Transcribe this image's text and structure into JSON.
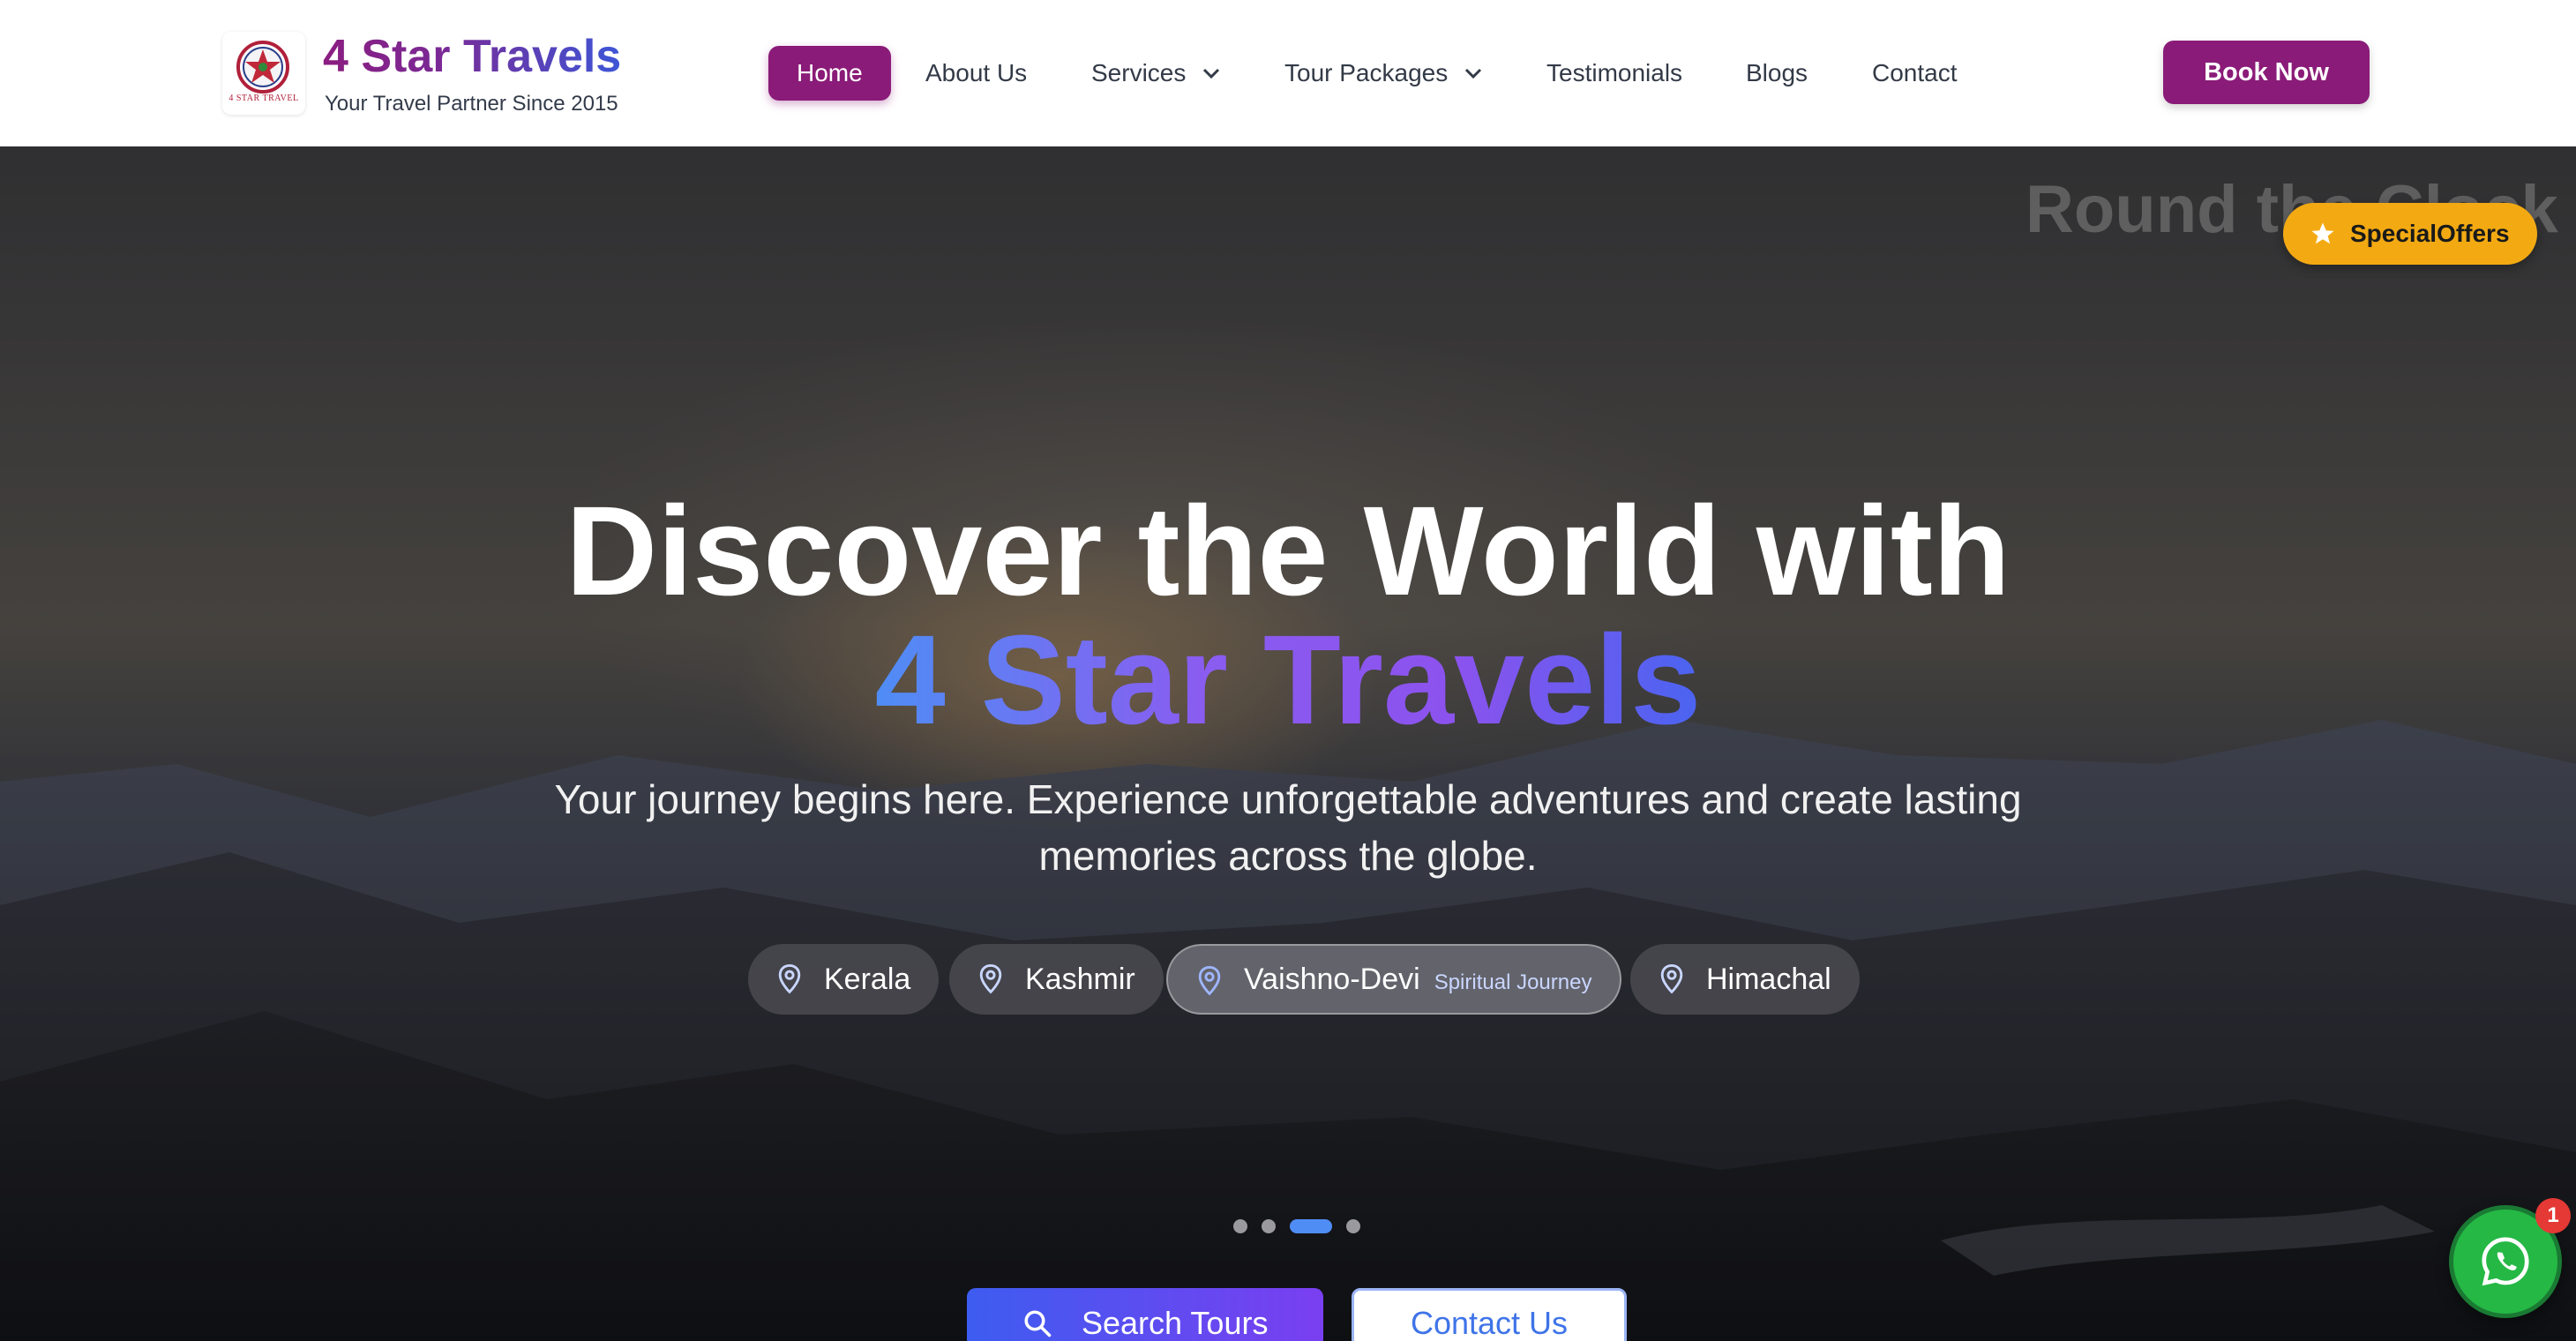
{
  "brand": {
    "name": "4 Star Travels",
    "tagline": "Your Travel Partner Since 2015",
    "logo_text": "4 STAR TRAVEL"
  },
  "nav": {
    "home": "Home",
    "about": "About Us",
    "services": "Services",
    "tour_packages": "Tour Packages",
    "testimonials": "Testimonials",
    "blogs": "Blogs",
    "contact": "Contact"
  },
  "header": {
    "book_now": "Book Now"
  },
  "hero": {
    "bg_caption": "Round the Clock",
    "offer_badge": "SpecialOffers",
    "title_line1": "Discover the World with",
    "title_line2": "4 Star Travels",
    "subtitle": "Your journey begins here. Experience unforgettable adventures and create lasting memories across the globe.",
    "destinations": [
      {
        "label": "Kerala"
      },
      {
        "label": "Kashmir"
      },
      {
        "label": "Vaishno-Devi",
        "sub": "Spiritual Journey",
        "active": true
      },
      {
        "label": "Himachal"
      }
    ],
    "carousel": {
      "slides": 4,
      "active_index": 2
    },
    "search_button": "Search Tours",
    "contact_button": "Contact Us"
  },
  "whatsapp": {
    "badge_count": "1"
  },
  "colors": {
    "brand_purple": "#8a1b78",
    "accent_blue": "#4f8df5",
    "accent_violet": "#8a5cf0",
    "offer_yellow": "#f3aa12",
    "whatsapp_green": "#25b845"
  },
  "icons": [
    "logo-star-icon",
    "chevron-down-icon",
    "star-icon",
    "map-pin-icon",
    "search-icon",
    "whatsapp-icon"
  ]
}
